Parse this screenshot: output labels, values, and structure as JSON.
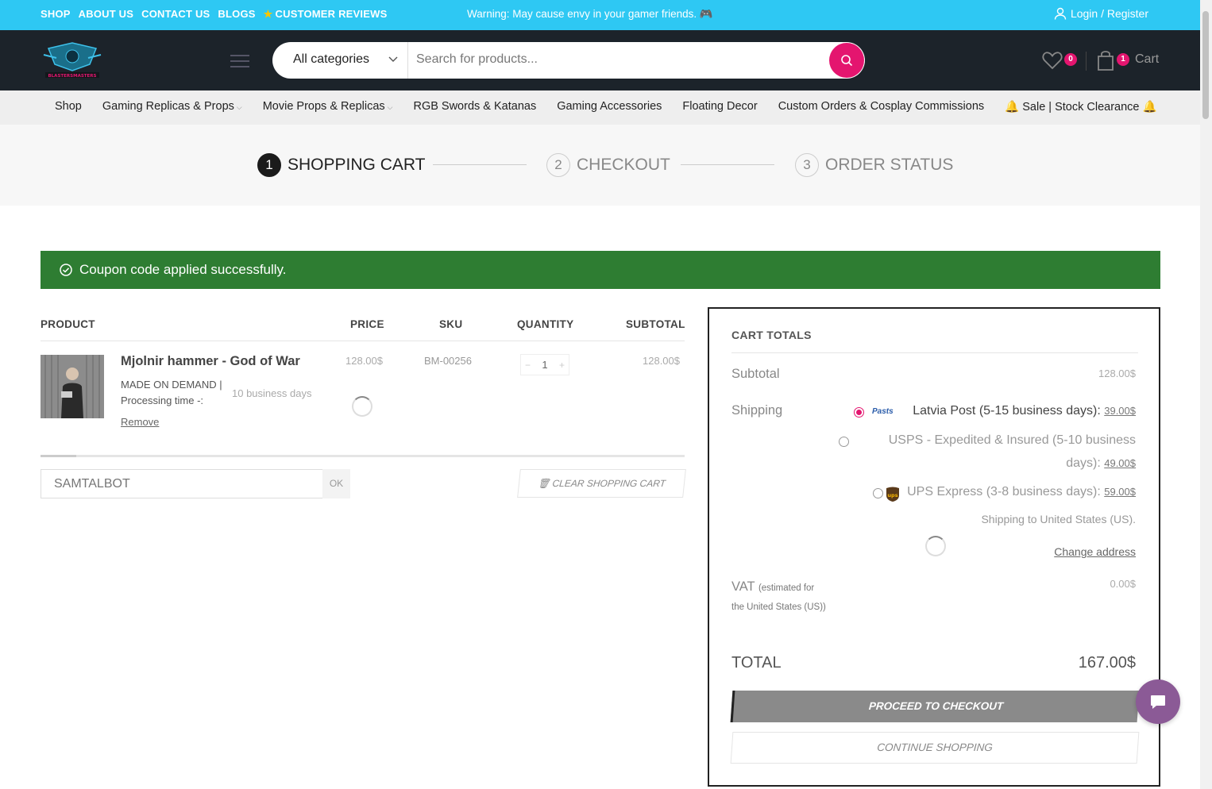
{
  "topbar": {
    "links": [
      "SHOP",
      "ABOUT US",
      "CONTACT US",
      "BLOGS",
      "CUSTOMER REVIEWS"
    ],
    "warning": "Warning: May cause envy in your gamer friends. 🎮",
    "login": "Login / Register"
  },
  "header": {
    "logo_text": "BLASTERSMASTERS",
    "search": {
      "category": "All categories",
      "placeholder": "Search for products..."
    },
    "wishlist_count": "0",
    "cart_count": "1",
    "cart_label": "Cart"
  },
  "nav": {
    "items": [
      "Shop",
      "Gaming Replicas & Props",
      "Movie Props & Replicas",
      "RGB Swords & Katanas",
      "Gaming Accessories",
      "Floating Decor",
      "Custom Orders & Cosplay Commissions",
      "🔔 Sale | Stock Clearance 🔔"
    ]
  },
  "steps": [
    {
      "num": "1",
      "label": "SHOPPING CART",
      "active": true
    },
    {
      "num": "2",
      "label": "CHECKOUT",
      "active": false
    },
    {
      "num": "3",
      "label": "ORDER STATUS",
      "active": false
    }
  ],
  "alert": "Coupon code applied successfully.",
  "table": {
    "headers": {
      "product": "PRODUCT",
      "price": "PRICE",
      "sku": "SKU",
      "quantity": "QUANTITY",
      "subtotal": "SUBTOTAL"
    },
    "row": {
      "name": "Mjolnir hammer - God of War",
      "meta1": "MADE ON DEMAND |",
      "meta2": "Processing time -:",
      "days": "10 business days",
      "remove": "Remove",
      "price": "128.00$",
      "sku": "BM-00256",
      "qty": "1",
      "subtotal": "128.00$"
    }
  },
  "coupon": {
    "value": "SAMTALBOT",
    "ok": "OK",
    "clear": "CLEAR SHOPPING CART"
  },
  "totals": {
    "title": "CART TOTALS",
    "subtotal_label": "Subtotal",
    "subtotal_value": "128.00$",
    "shipping_label": "Shipping",
    "options": [
      {
        "name": "Latvia Post (5-15 business days):",
        "price": "39.00$",
        "selected": true
      },
      {
        "name_line1": "USPS - Expedited & Insured (5-10 business",
        "name_line2": "days):",
        "price": "49.00$",
        "selected": false
      },
      {
        "name": "UPS Express (3-8 business days):",
        "price": "59.00$",
        "selected": false
      }
    ],
    "latvia_logo": "Pasts",
    "ups_logo": "ups",
    "shipping_to": "Shipping to United States (US).",
    "change_address": "Change address",
    "vat_label": "VAT",
    "vat_note": "(estimated for the United States (US))",
    "vat_value": "0.00$",
    "total_label": "TOTAL",
    "total_value": "167.00$",
    "checkout": "PROCEED TO CHECKOUT",
    "continue": "CONTINUE SHOPPING"
  },
  "colors": {
    "topbar": "#2ec8f3",
    "header": "#1c232a",
    "accent": "#e4156f",
    "alert": "#2e7d32",
    "chat": "#8b5a96"
  }
}
